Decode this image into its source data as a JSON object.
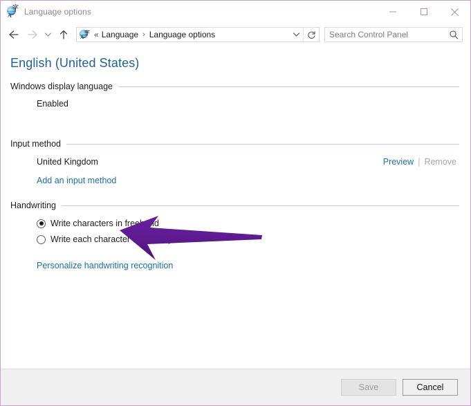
{
  "window": {
    "title": "Language options",
    "title_icon": "language-globe-icon",
    "controls": {
      "minimize": "minimize-icon",
      "maximize": "maximize-icon",
      "close": "close-icon"
    }
  },
  "toolbar": {
    "back": "back-arrow-icon",
    "forward": "forward-arrow-icon",
    "recent": "chevron-down-icon",
    "up": "up-arrow-icon",
    "address": {
      "icon": "language-globe-icon",
      "double_chevron": "«",
      "crumbs": [
        "Language",
        "Language options"
      ],
      "separator": "›",
      "dropdown": "chevron-down-icon",
      "refresh": "refresh-icon"
    },
    "search": {
      "placeholder": "Search Control Panel",
      "value": "",
      "icon": "search-icon"
    }
  },
  "main": {
    "page_title": "English (United States)",
    "sections": [
      {
        "heading": "Windows display language",
        "status": "Enabled"
      },
      {
        "heading": "Input method",
        "input_methods": [
          {
            "name": "United Kingdom",
            "preview_label": "Preview",
            "separator": "|",
            "remove_label": "Remove",
            "remove_enabled": false
          }
        ],
        "add_link": "Add an input method"
      },
      {
        "heading": "Handwriting",
        "options": [
          {
            "label": "Write characters in freehand",
            "selected": true
          },
          {
            "label": "Write each character separately",
            "selected": false
          }
        ],
        "personalize_link": "Personalize handwriting recognition"
      }
    ]
  },
  "footer": {
    "save_label": "Save",
    "save_enabled": false,
    "cancel_label": "Cancel",
    "cancel_enabled": true
  },
  "annotation": {
    "type": "arrow",
    "direction": "left",
    "color": "#5C1A8F",
    "points_at": "Add an input method"
  },
  "colors": {
    "window_border": "#c9a2c9",
    "page_title": "#1f6296",
    "link": "#1a6fb5",
    "disabled_text": "#a6a6a6",
    "rule": "#d6c6d9",
    "footer_bg": "#f0f0f0",
    "annotation_purple": "#5C1A8F"
  }
}
